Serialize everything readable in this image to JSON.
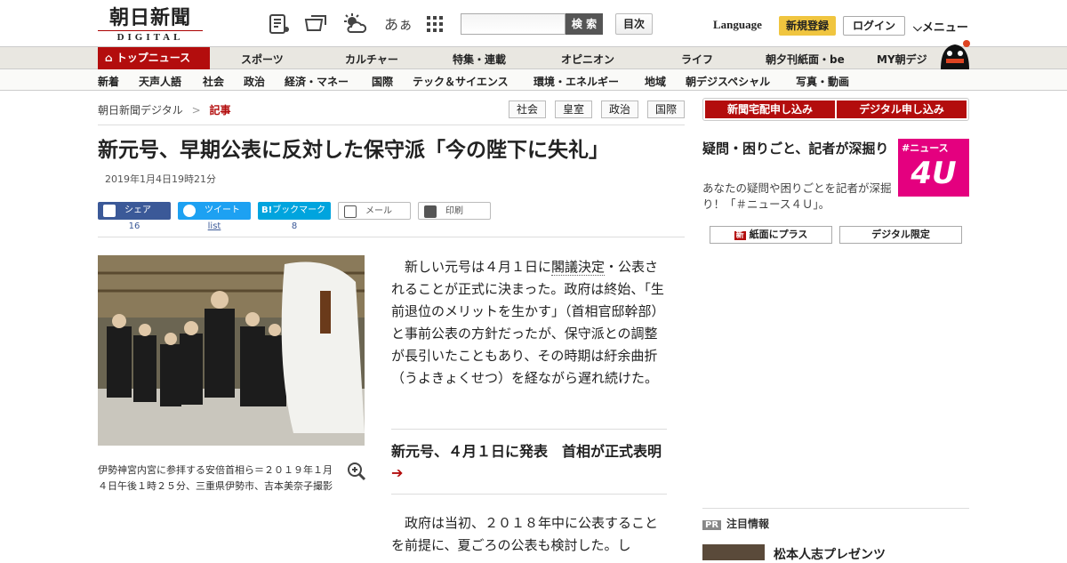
{
  "header": {
    "logo_jp": "朝日新聞",
    "logo_en": "DIGITAL",
    "search_placeholder": "",
    "search_button": "検 索",
    "toc_button": "目次",
    "language": "Language",
    "register": "新規登録",
    "login": "ログイン",
    "menu": "メニュー",
    "icon_text_size": "あぁ"
  },
  "gnav": [
    "トップニュース",
    "スポーツ",
    "カルチャー",
    "特集・連載",
    "オピニオン",
    "ライフ",
    "朝夕刊紙面・be",
    "MY朝デジ"
  ],
  "snav": [
    "新着",
    "天声人語",
    "社会",
    "政治",
    "経済・マネー",
    "国際",
    "テック＆サイエンス",
    "環境・エネルギー",
    "地域",
    "朝デジスペシャル",
    "写真・動画"
  ],
  "breadcrumb": {
    "home": "朝日新聞デジタル",
    "sep": ">",
    "current": "記事"
  },
  "tags": [
    "社会",
    "皇室",
    "政治",
    "国際"
  ],
  "article": {
    "headline": "新元号、早期公表に反対した保守派「今の陛下に失礼」",
    "date": "2019年1月4日19時21分",
    "share": {
      "facebook": "シェア",
      "facebook_count": "16",
      "twitter": "ツイート",
      "twitter_count": "list",
      "hatena": "ブックマーク",
      "hatena_prefix": "B!",
      "hatena_count": "8",
      "mail": "メール",
      "print": "印刷"
    },
    "caption": "伊勢神宮内宮に参拝する安倍首相ら＝２０１９年１月４日午後１時２５分、三重県伊勢市、吉本美奈子撮影",
    "para1_a": "新しい元号は４月１日に",
    "para1_link": "閣議決定",
    "para1_b": "・公表されることが正式に決まった。政府は終始、「生前退位のメリットを生かす」（首相官邸幹部）と事前公表の方針だったが、保守派との調整が長引いたこともあり、その時期は紆余曲折（うよきょくせつ）を経ながら遅れ続けた。",
    "related": "新元号、４月１日に発表　首相が正式表明",
    "para2": "政府は当初、２０１８年中に公表することを前提に、夏ごろの公表も検討した。し"
  },
  "sidebar": {
    "ad_left": "新聞宅配申し込み",
    "ad_right": "デジタル申し込み",
    "title": "疑問・困りごと、記者が深掘り",
    "desc": "あなたの疑問や困りごとを記者が深掘り！「＃ニュース４Ｕ」。",
    "badge_top": "#ニュース",
    "badge_main": "4U",
    "btn_paper": "紙面にプラス",
    "btn_digital": "デジタル限定",
    "pr_label": "PR",
    "pr_heading": "注目情報",
    "pr_item": "松本人志プレゼンツ"
  },
  "colors": {
    "brand_red": "#b30d0d",
    "facebook": "#3b5998",
    "twitter": "#1da1f2",
    "hatena": "#00a4de",
    "register": "#f0c53f",
    "news4u": "#e4007f"
  }
}
